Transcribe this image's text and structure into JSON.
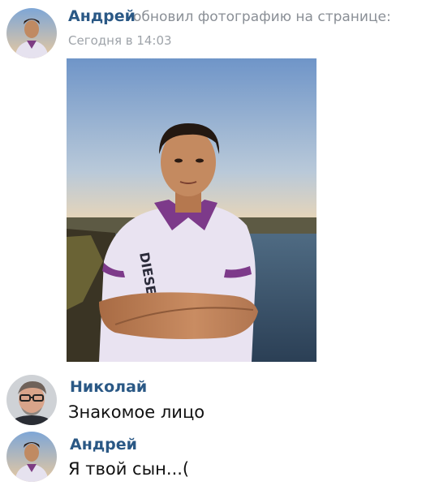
{
  "post": {
    "author": "Андрей",
    "action": "обновил фотографию на странице:",
    "time": "Сегодня в 14:03",
    "photo": {
      "alt": "photo",
      "shirt_text": "DIESEL"
    }
  },
  "comments": [
    {
      "author": "Николай",
      "text": "Знакомое лицо"
    },
    {
      "author": "Андрей",
      "text": "Я твой сын...("
    }
  ],
  "colors": {
    "link": "#2a5885",
    "meta": "#8a8f96",
    "text": "#111111"
  }
}
